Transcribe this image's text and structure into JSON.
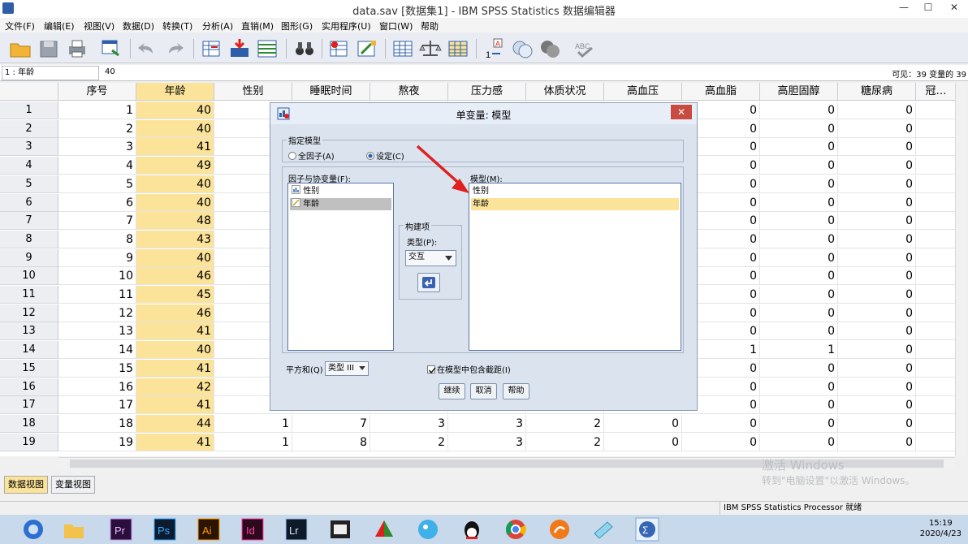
{
  "window": {
    "title": "data.sav [数据集1] - IBM SPSS Statistics 数据编辑器"
  },
  "menu": [
    "文件(F)",
    "编辑(E)",
    "视图(V)",
    "数据(D)",
    "转换(T)",
    "分析(A)",
    "直销(M)",
    "图形(G)",
    "实用程序(U)",
    "窗口(W)",
    "帮助"
  ],
  "cellbar": {
    "ref": "1 : 年龄",
    "value": "40",
    "visible": "可见：39 变量的 39"
  },
  "columns": [
    "序号",
    "年龄",
    "性别",
    "睡眠时间",
    "熬夜",
    "压力感",
    "体质状况",
    "高血压",
    "高血脂",
    "高胆固醇",
    "糖尿病",
    "冠…"
  ],
  "rows": [
    {
      "n": "1",
      "v": [
        "1",
        "40",
        "",
        "",
        "",
        "",
        "",
        "",
        "0",
        "0",
        "0",
        ""
      ]
    },
    {
      "n": "2",
      "v": [
        "2",
        "40",
        "",
        "",
        "",
        "",
        "",
        "",
        "0",
        "0",
        "0",
        ""
      ]
    },
    {
      "n": "3",
      "v": [
        "3",
        "41",
        "",
        "",
        "",
        "",
        "",
        "",
        "0",
        "0",
        "0",
        ""
      ]
    },
    {
      "n": "4",
      "v": [
        "4",
        "49",
        "",
        "",
        "",
        "",
        "",
        "",
        "0",
        "0",
        "0",
        ""
      ]
    },
    {
      "n": "5",
      "v": [
        "5",
        "40",
        "",
        "",
        "",
        "",
        "",
        "",
        "0",
        "0",
        "0",
        ""
      ]
    },
    {
      "n": "6",
      "v": [
        "6",
        "40",
        "",
        "",
        "",
        "",
        "",
        "",
        "0",
        "0",
        "0",
        ""
      ]
    },
    {
      "n": "7",
      "v": [
        "7",
        "48",
        "",
        "",
        "",
        "",
        "",
        "",
        "0",
        "0",
        "0",
        ""
      ]
    },
    {
      "n": "8",
      "v": [
        "8",
        "43",
        "",
        "",
        "",
        "",
        "",
        "",
        "0",
        "0",
        "0",
        ""
      ]
    },
    {
      "n": "9",
      "v": [
        "9",
        "40",
        "",
        "",
        "",
        "",
        "",
        "",
        "0",
        "0",
        "0",
        ""
      ]
    },
    {
      "n": "10",
      "v": [
        "10",
        "46",
        "",
        "",
        "",
        "",
        "",
        "",
        "0",
        "0",
        "0",
        ""
      ]
    },
    {
      "n": "11",
      "v": [
        "11",
        "45",
        "",
        "",
        "",
        "",
        "",
        "",
        "0",
        "0",
        "0",
        ""
      ]
    },
    {
      "n": "12",
      "v": [
        "12",
        "46",
        "",
        "",
        "",
        "",
        "",
        "",
        "0",
        "0",
        "0",
        ""
      ]
    },
    {
      "n": "13",
      "v": [
        "13",
        "41",
        "",
        "",
        "",
        "",
        "",
        "",
        "0",
        "0",
        "0",
        ""
      ]
    },
    {
      "n": "14",
      "v": [
        "14",
        "40",
        "",
        "",
        "",
        "",
        "",
        "",
        "1",
        "1",
        "0",
        ""
      ]
    },
    {
      "n": "15",
      "v": [
        "15",
        "41",
        "",
        "",
        "",
        "",
        "",
        "",
        "0",
        "0",
        "0",
        ""
      ]
    },
    {
      "n": "16",
      "v": [
        "16",
        "42",
        "",
        "",
        "",
        "",
        "",
        "",
        "0",
        "0",
        "0",
        ""
      ]
    },
    {
      "n": "17",
      "v": [
        "17",
        "41",
        "",
        "",
        "",
        "",
        "",
        "",
        "0",
        "0",
        "0",
        ""
      ]
    },
    {
      "n": "18",
      "v": [
        "18",
        "44",
        "1",
        "7",
        "3",
        "3",
        "2",
        "0",
        "0",
        "0",
        "0",
        ""
      ]
    },
    {
      "n": "19",
      "v": [
        "19",
        "41",
        "1",
        "8",
        "2",
        "3",
        "2",
        "0",
        "0",
        "0",
        "0",
        ""
      ]
    }
  ],
  "viewtabs": [
    "数据视图",
    "变量视图"
  ],
  "status": "IBM SPSS Statistics Processor 就绪",
  "watermark": {
    "line1": "激活 Windows",
    "line2": "转到\"电脑设置\"以激活 Windows。"
  },
  "dialog": {
    "title": "单变量: 模型",
    "spec_group": "指定模型",
    "radio_full": "全因子(A)",
    "radio_custom": "设定(C)",
    "factors_label": "因子与协变量(F):",
    "factors": [
      "性别",
      "年龄"
    ],
    "model_label": "模型(M):",
    "model": [
      "性别",
      "年龄"
    ],
    "build_group": "构建项",
    "type_label": "类型(P):",
    "type_value": "交互",
    "ss_label": "平方和(Q)",
    "ss_value": "类型 III",
    "intercept_label": "在模型中包含截距(I)",
    "btn_continue": "继续",
    "btn_cancel": "取消",
    "btn_help": "帮助"
  },
  "taskbar": {
    "time": "15:19",
    "date": "2020/4/23"
  },
  "colors": {
    "selected_column": "#fbe39a",
    "arrow": "#e0201c"
  }
}
